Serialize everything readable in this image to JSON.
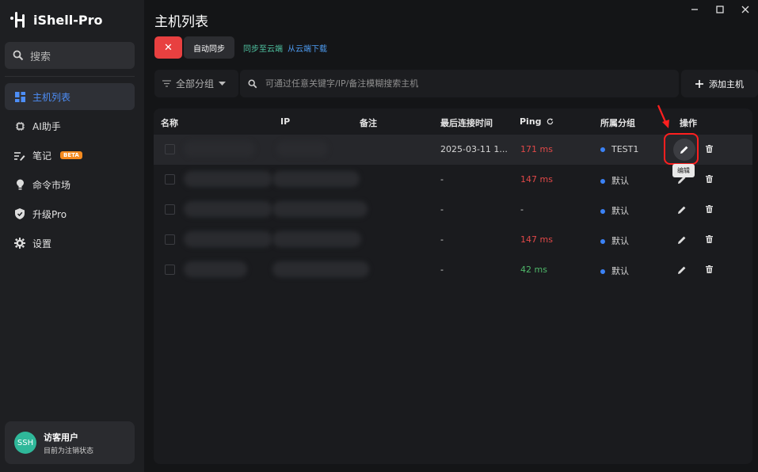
{
  "app": {
    "name": "iShell-Pro"
  },
  "sidebar": {
    "search_label": "搜索",
    "items": [
      {
        "label": "主机列表",
        "icon": "grid-icon",
        "active": true
      },
      {
        "label": "AI助手",
        "icon": "chip-icon"
      },
      {
        "label": "笔记",
        "icon": "note-icon",
        "badge": "BETA"
      },
      {
        "label": "命令市场",
        "icon": "lightbulb-icon"
      },
      {
        "label": "升级Pro",
        "icon": "shield-icon"
      },
      {
        "label": "设置",
        "icon": "gear-icon"
      }
    ],
    "user": {
      "avatar_text": "SSH",
      "name": "访客用户",
      "status": "目前为注销状态"
    }
  },
  "main": {
    "title": "主机列表",
    "toolbar": {
      "close_symbol": "✕",
      "auto_sync": "自动同步",
      "sync_to_cloud": "同步至云端",
      "download_from_cloud": "从云端下载"
    },
    "group_select": "全部分组",
    "search_placeholder": "可通过任意关键字/IP/备注模糊搜索主机",
    "add_host": "添加主机",
    "table": {
      "headers": [
        "名称",
        "IP",
        "备注",
        "最后连接时间",
        "Ping",
        "所属分组",
        "操作"
      ],
      "rows": [
        {
          "last_conn": "2025-03-11 1...",
          "ping": "171 ms",
          "ping_status": "red",
          "group": "TEST1"
        },
        {
          "last_conn": "-",
          "ping": "147 ms",
          "ping_status": "red",
          "group": "默认"
        },
        {
          "last_conn": "-",
          "ping": "-",
          "ping_status": "none",
          "group": "默认"
        },
        {
          "last_conn": "-",
          "ping": "147 ms",
          "ping_status": "red",
          "group": "默认"
        },
        {
          "last_conn": "-",
          "ping": "42 ms",
          "ping_status": "green",
          "group": "默认"
        }
      ]
    },
    "tooltip": "编辑"
  },
  "colors": {
    "accent": "#4d8ef7",
    "danger": "#e84040",
    "ping_bad": "#e04848",
    "ping_good": "#4fb86a",
    "highlight": "#ff1f1f"
  }
}
